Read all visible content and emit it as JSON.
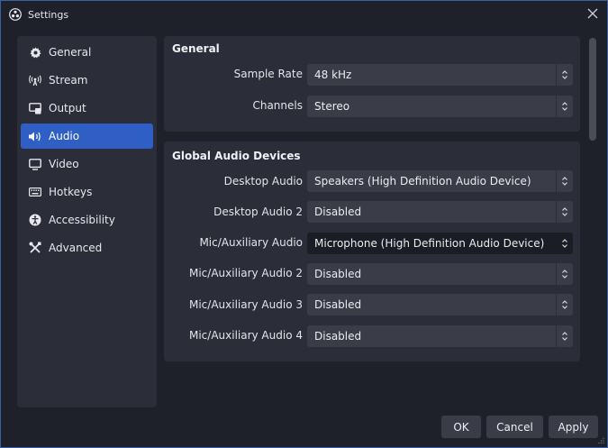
{
  "window": {
    "title": "Settings"
  },
  "sidebar": {
    "items": [
      {
        "label": "General",
        "icon": "gear-icon",
        "active": false
      },
      {
        "label": "Stream",
        "icon": "broadcast-icon",
        "active": false
      },
      {
        "label": "Output",
        "icon": "output-icon",
        "active": false
      },
      {
        "label": "Audio",
        "icon": "speaker-icon",
        "active": true
      },
      {
        "label": "Video",
        "icon": "monitor-icon",
        "active": false
      },
      {
        "label": "Hotkeys",
        "icon": "keyboard-icon",
        "active": false
      },
      {
        "label": "Accessibility",
        "icon": "accessibility-icon",
        "active": false
      },
      {
        "label": "Advanced",
        "icon": "tools-icon",
        "active": false
      }
    ]
  },
  "general": {
    "title": "General",
    "rows": [
      {
        "label": "Sample Rate",
        "value": "48 kHz"
      },
      {
        "label": "Channels",
        "value": "Stereo"
      }
    ]
  },
  "devices": {
    "title": "Global Audio Devices",
    "rows": [
      {
        "label": "Desktop Audio",
        "value": "Speakers (High Definition Audio Device)"
      },
      {
        "label": "Desktop Audio 2",
        "value": "Disabled"
      },
      {
        "label": "Mic/Auxiliary Audio",
        "value": "Microphone (High Definition Audio Device)"
      },
      {
        "label": "Mic/Auxiliary Audio 2",
        "value": "Disabled"
      },
      {
        "label": "Mic/Auxiliary Audio 3",
        "value": "Disabled"
      },
      {
        "label": "Mic/Auxiliary Audio 4",
        "value": "Disabled"
      }
    ]
  },
  "buttons": {
    "ok": "OK",
    "cancel": "Cancel",
    "apply": "Apply"
  },
  "colors": {
    "accent": "#2f5fc4",
    "background": "#1f212a",
    "panel": "#2b2e38",
    "field": "#3a3d48"
  }
}
